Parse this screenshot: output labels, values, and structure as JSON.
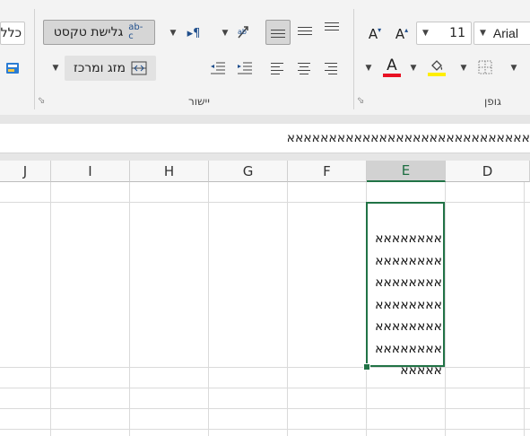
{
  "ribbon": {
    "alignment": {
      "label": "יישור",
      "wrap_text_label": "גלישת טקסט",
      "merge_center_label": "מזג ומרכז",
      "wrap_icon": "ab-c",
      "paragraph_icon": "¶"
    },
    "font": {
      "label": "גופן",
      "font_name": "Arial",
      "font_size": "11",
      "grow_label": "A",
      "shrink_label": "A",
      "font_color_label": "A",
      "font_color": "#e81123",
      "highlight_color": "#ffee00"
    },
    "clipboard": {
      "partial_label": "כלל"
    }
  },
  "formula_bar": {
    "content": "אאאאאאאאאאאאאאאאאאאאאאאאאאאאאאאאאאאאאאאאאאאאא"
  },
  "columns": [
    "J",
    "I",
    "H",
    "G",
    "F",
    "E",
    "D"
  ],
  "selected_column": "E",
  "cell_text": "אאאאאאאא\nאאאאאאאא\nאאאאאאאא\nאאאאאאאא\nאאאאאאאא\nאאאאאאאא\nאאאאא",
  "colors": {
    "accent": "#217346"
  }
}
